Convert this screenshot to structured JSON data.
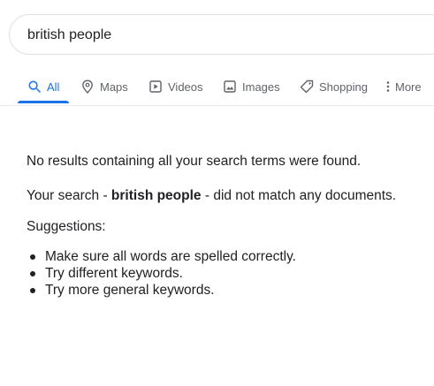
{
  "search": {
    "query": "british people"
  },
  "tabs": [
    {
      "label": "All",
      "icon": "search-icon"
    },
    {
      "label": "Maps",
      "icon": "map-pin-icon"
    },
    {
      "label": "Videos",
      "icon": "video-play-icon"
    },
    {
      "label": "Images",
      "icon": "image-icon"
    },
    {
      "label": "Shopping",
      "icon": "tag-icon"
    },
    {
      "label": "More",
      "icon": "more-vertical-icon"
    }
  ],
  "active_tab": "All",
  "message": {
    "no_results": "No results containing all your search terms were found.",
    "did_not_match_prefix": "Your search - ",
    "did_not_match_query": "british people",
    "did_not_match_suffix": " - did not match any documents.",
    "suggestions_title": "Suggestions:",
    "suggestions": [
      "Make sure all words are spelled correctly.",
      "Try different keywords.",
      "Try more general keywords."
    ]
  },
  "colors": {
    "accent": "#1a73e8",
    "tab_text": "#5f6368",
    "body_text": "#202124",
    "border": "#dfe1e5"
  }
}
